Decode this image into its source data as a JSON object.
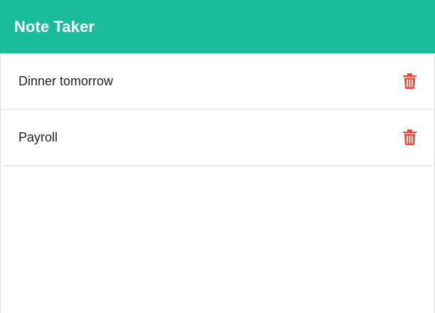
{
  "navbar": {
    "title": "Note Taker",
    "background": "#1abc9c"
  },
  "notes": [
    {
      "title": "Dinner tomorrow",
      "action_icon": "trash-icon"
    },
    {
      "title": "Payroll",
      "action_icon": "trash-icon"
    }
  ],
  "colors": {
    "accent": "#1abc9c",
    "delete": "#e74c3c"
  }
}
